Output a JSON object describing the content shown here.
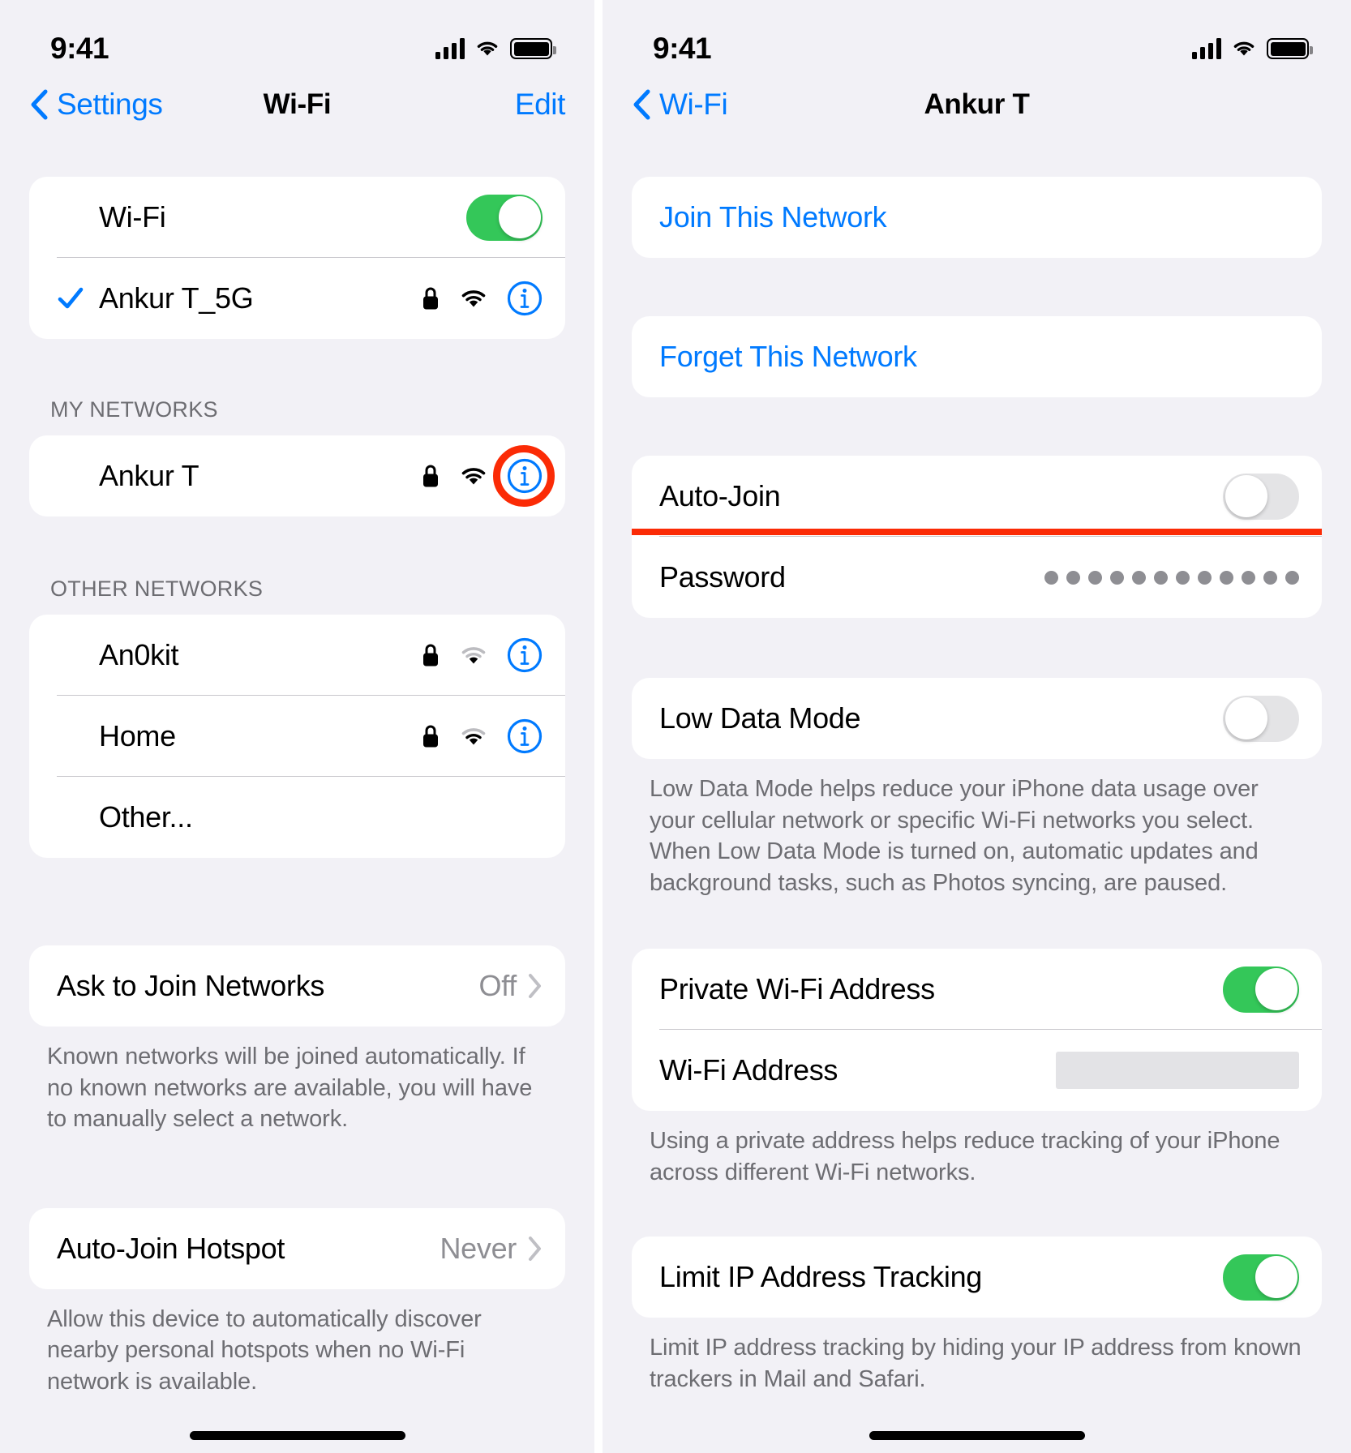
{
  "left": {
    "status": {
      "time": "9:41",
      "icons": [
        "cellular-bars-icon",
        "wifi-icon",
        "battery-icon"
      ]
    },
    "nav": {
      "back_label": "Settings",
      "title": "Wi-Fi",
      "action_label": "Edit"
    },
    "wifi_toggle": {
      "label": "Wi-Fi",
      "state": "on"
    },
    "connected_network": {
      "name": "Ankur T_5G",
      "checked": true,
      "secured": true,
      "signal": "strong",
      "info_label": "i"
    },
    "my_networks": {
      "header": "MY NETWORKS",
      "items": [
        {
          "name": "Ankur T",
          "secured": true,
          "signal": "strong",
          "highlighted": true
        }
      ]
    },
    "other_networks": {
      "header": "OTHER NETWORKS",
      "items": [
        {
          "name": "An0kit",
          "secured": true,
          "signal": "weak",
          "has_info": true
        },
        {
          "name": "Home",
          "secured": true,
          "signal": "medium",
          "has_info": true
        },
        {
          "name": "Other...",
          "secured": false,
          "signal": "none",
          "has_info": false
        }
      ]
    },
    "ask_to_join": {
      "label": "Ask to Join Networks",
      "value": "Off",
      "footnote": "Known networks will be joined automatically. If no known networks are available, you will have to manually select a network."
    },
    "auto_join_hotspot": {
      "label": "Auto-Join Hotspot",
      "value": "Never",
      "footnote": "Allow this device to automatically discover nearby personal hotspots when no Wi-Fi network is available."
    }
  },
  "right": {
    "status": {
      "time": "9:41",
      "icons": [
        "cellular-bars-icon",
        "wifi-icon",
        "battery-icon"
      ]
    },
    "nav": {
      "back_label": "Wi-Fi",
      "title": "Ankur T"
    },
    "join_network": {
      "label": "Join This Network"
    },
    "forget_network": {
      "label": "Forget This Network"
    },
    "auto_join": {
      "label": "Auto-Join",
      "state": "off",
      "highlighted": true
    },
    "password": {
      "label": "Password",
      "masked_value": "••••••••••••",
      "dot_count": 12
    },
    "low_data_mode": {
      "label": "Low Data Mode",
      "state": "off",
      "footnote": "Low Data Mode helps reduce your iPhone data usage over your cellular network or specific Wi-Fi networks you select. When Low Data Mode is turned on, automatic updates and background tasks, such as Photos syncing, are paused."
    },
    "private_wifi_address": {
      "label": "Private Wi-Fi Address",
      "state": "on"
    },
    "wifi_address": {
      "label": "Wi-Fi Address",
      "value": "",
      "footnote": "Using a private address helps reduce tracking of your iPhone across different Wi-Fi networks."
    },
    "limit_ip_tracking": {
      "label": "Limit IP Address Tracking",
      "state": "on",
      "footnote": "Limit IP address tracking by hiding your IP address from known trackers in Mail and Safari."
    }
  },
  "colors": {
    "accent_blue": "#007aff",
    "toggle_green": "#34c759",
    "highlight_red": "#fb2b06",
    "page_bg": "#f2f1f6",
    "card_bg": "#ffffff",
    "secondary_text": "#6d6d72"
  }
}
